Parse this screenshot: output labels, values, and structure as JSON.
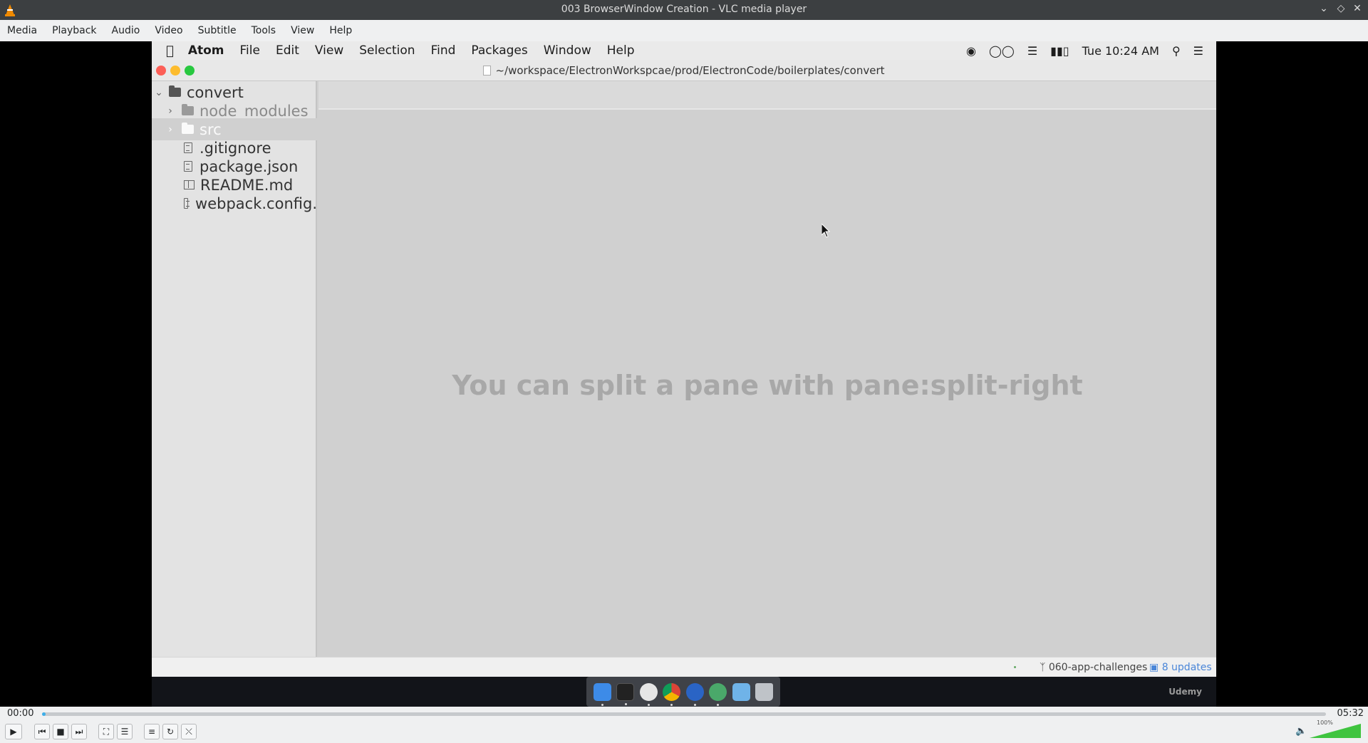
{
  "vlc": {
    "title": "003 BrowserWindow Creation - VLC media player",
    "menu": [
      "Media",
      "Playback",
      "Audio",
      "Video",
      "Subtitle",
      "Tools",
      "View",
      "Help"
    ],
    "time_current": "00:00",
    "time_total": "05:32",
    "progress_fraction": 0.003,
    "volume_label": "100%"
  },
  "mac_menubar": {
    "app_name": "Atom",
    "items": [
      "File",
      "Edit",
      "View",
      "Selection",
      "Find",
      "Packages",
      "Window",
      "Help"
    ],
    "clock": "Tue 10:24 AM"
  },
  "atom": {
    "path": "~/workspace/ElectronWorkspcae/prod/ElectronCode/boilerplates/convert",
    "tree": {
      "root": "convert",
      "folders": [
        "node_modules",
        "src"
      ],
      "files": [
        ".gitignore",
        "package.json",
        "README.md",
        "webpack.config."
      ]
    },
    "tip": "You can split a pane with pane:split-right",
    "status": {
      "branch": "060-app-challenges",
      "updates": "8 updates"
    }
  },
  "watermark": "Udemy",
  "colors": {
    "close": "#fc5f57",
    "minimize": "#fdbc2e",
    "maximize": "#28c840",
    "accent": "#3daee9"
  }
}
